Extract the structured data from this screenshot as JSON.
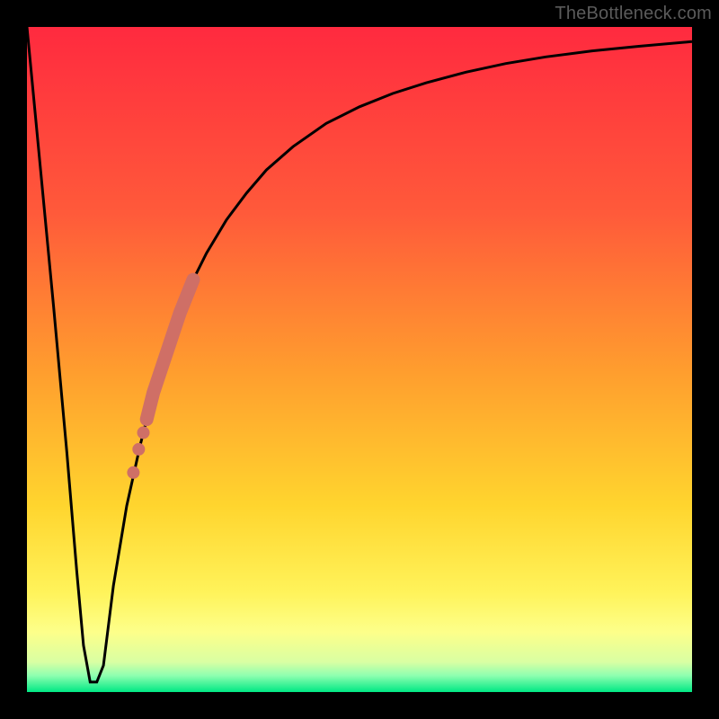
{
  "attribution": "TheBottleneck.com",
  "chart_data": {
    "type": "line",
    "title": "",
    "xlabel": "",
    "ylabel": "",
    "xlim": [
      0,
      100
    ],
    "ylim": [
      0,
      100
    ],
    "gradient_stops": [
      {
        "offset": 0.0,
        "color": "#ff2a3f"
      },
      {
        "offset": 0.28,
        "color": "#ff5a3a"
      },
      {
        "offset": 0.52,
        "color": "#ff9e2e"
      },
      {
        "offset": 0.72,
        "color": "#ffd52e"
      },
      {
        "offset": 0.85,
        "color": "#fff35a"
      },
      {
        "offset": 0.91,
        "color": "#fdff8a"
      },
      {
        "offset": 0.955,
        "color": "#d9ffa3"
      },
      {
        "offset": 0.975,
        "color": "#8fffb0"
      },
      {
        "offset": 1.0,
        "color": "#00e884"
      }
    ],
    "series": [
      {
        "name": "bottleneck-curve",
        "type": "line",
        "x": [
          0.0,
          2.0,
          4.0,
          6.0,
          7.5,
          8.5,
          9.5,
          10.5,
          11.5,
          12.0,
          13.0,
          15.0,
          17.0,
          19.0,
          21.0,
          23.0,
          25.0,
          27.0,
          30.0,
          33.0,
          36.0,
          40.0,
          45.0,
          50.0,
          55.0,
          60.0,
          66.0,
          72.0,
          78.0,
          85.0,
          92.0,
          100.0
        ],
        "y": [
          100.0,
          79.0,
          58.0,
          36.0,
          18.0,
          7.0,
          1.5,
          1.5,
          4.0,
          8.0,
          16.0,
          28.0,
          37.0,
          45.0,
          51.0,
          57.0,
          62.0,
          66.0,
          71.0,
          75.0,
          78.5,
          82.0,
          85.5,
          88.0,
          90.0,
          91.6,
          93.2,
          94.5,
          95.5,
          96.4,
          97.1,
          97.8
        ]
      },
      {
        "name": "highlight-band",
        "type": "line",
        "x": [
          18.0,
          19.0,
          20.0,
          21.0,
          22.0,
          23.0,
          24.0,
          25.0
        ],
        "y": [
          41.0,
          45.0,
          48.0,
          51.0,
          54.0,
          57.0,
          59.5,
          62.0
        ]
      },
      {
        "name": "highlight-dots",
        "type": "scatter",
        "x": [
          16.0,
          16.8,
          17.5
        ],
        "y": [
          33.0,
          36.5,
          39.0
        ]
      }
    ],
    "colors": {
      "curve": "#000000",
      "highlight": "#cf6f66"
    }
  }
}
